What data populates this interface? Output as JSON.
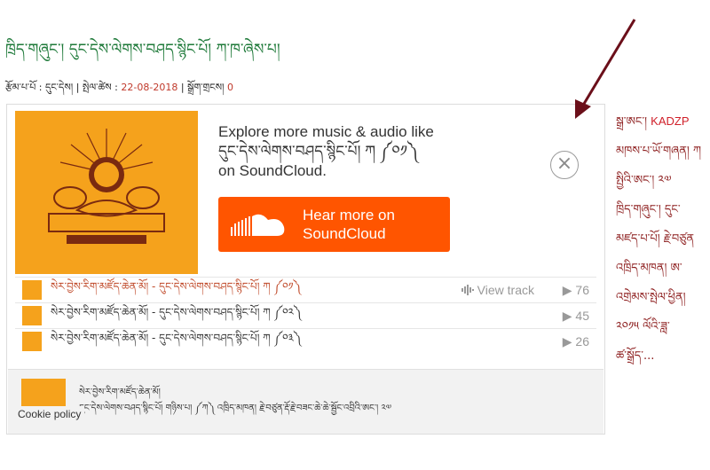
{
  "page": {
    "title": "ཁྲིད་གཞུང་། དུང་དེས་ལེགས་བཤད་སྙིང་པོ། ཀ་ཁ་ཞེས་པ།",
    "meta": {
      "author_label": "རྩོམ་པ་པོ : ",
      "author": "དུང་དེས།",
      "date_label": " | སྤེལ་ཚེས : ",
      "date": "22-08-2018",
      "comments_label": " | སྒྲོག་གྲངས། ",
      "comments": "0"
    }
  },
  "widget": {
    "prompt_line1": "Explore more music & audio like",
    "prompt_line2": "དུང་དེས་ལེགས་བཤད་སྙིང་པོ། ཀ ༼༠༡༽",
    "prompt_line3": "on SoundCloud.",
    "cta_line1": "Hear more on",
    "cta_line2": "SoundCloud",
    "close_symbol": "×",
    "view_track_label": "View track",
    "tracks": [
      {
        "title": "སེར་བྱེས་རིག་མཛོད་ཆེན་མོ། - དུང་དེས་ལེགས་བཤད་སྙིང་པོ། ཀ ༼༠༡༽",
        "plays": "76"
      },
      {
        "title": "སེར་བྱེས་རིག་མཛོད་ཆེན་མོ། - དུང་དེས་ལེགས་བཤད་སྙིང་པོ། ཀ ༼༠༢༽",
        "plays": "45"
      },
      {
        "title": "སེར་བྱེས་རིག་མཛོད་ཆེན་མོ། - དུང་དེས་ལེགས་བཤད་སྙིང་པོ། ཀ ༼༠༣༽",
        "plays": "26"
      }
    ],
    "footer_line1": "སེར་བྱེས་རིག་མཛོད་ཆེན་མོ།",
    "footer_line2": "དུང་དེས་ལེགས་བཤད་སྙིང་པོ། གཉིས་པ། ༼ཀ༽ འཁྲིད་མཁན། རྗེ་བཙུན་རྡོ་རྗེ་བཟང་ཆེ་ཆེ་སྦྱོང་འབྲིའི་ཨང་། ༢༧",
    "cookie_policy": "Cookie policy"
  },
  "sidebar": {
    "items": [
      "སྒྲ་ཨང་། ",
      "KADZP",
      "མཁས་པ་ཡོ་གཞན། ཀ",
      "སྤྱིའི་ཨང་། ༢༧",
      "ཁྲིད་གཞུང་། དུང་",
      "མཛད་པ་པོ། རྗེ་བཙུན",
      "འཁྲིད་མཁན། ཨ་",
      "འགྲེམས་སྤེལ་ཕྱིན།",
      "༢༠༡༥ ལོའི་ཟླ་",
      "ཚ་སྒྲོད་..."
    ]
  },
  "colors": {
    "accent": "#ff5500",
    "artwork": "#f5a21c",
    "title_green": "#1f7a3a",
    "sidebar_red": "#8b1a1a",
    "arrow": "#6b0f1a"
  },
  "icons": {
    "close": "close-icon",
    "cloud": "soundcloud-logo-icon",
    "waveform": "waveform-icon",
    "play": "play-icon",
    "arrow": "annotation-arrow-icon"
  }
}
